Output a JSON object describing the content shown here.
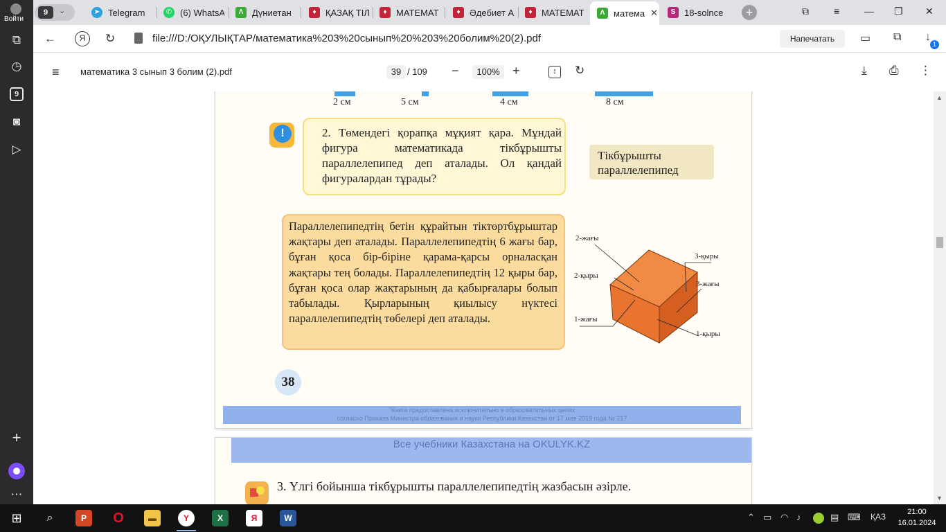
{
  "tab_strip": {
    "profile_label": "Войти",
    "tab_group_count": "9",
    "tabs": [
      {
        "title": "Telegram",
        "fav": "",
        "color": "#2aa3e0"
      },
      {
        "title": "(6) WhatsA",
        "fav": "",
        "color": "#25d366"
      },
      {
        "title": "Дүниетан",
        "fav": "Λ",
        "color": "#3aa935"
      },
      {
        "title": "ҚАЗАҚ ТІЛ",
        "fav": "",
        "color": "#c2253a"
      },
      {
        "title": "МАТЕМАТ",
        "fav": "",
        "color": "#c2253a"
      },
      {
        "title": "Әдебиет А",
        "fav": "",
        "color": "#c2253a"
      },
      {
        "title": "МАТЕМАТ",
        "fav": "",
        "color": "#c2253a"
      },
      {
        "title": "матема",
        "fav": "Λ",
        "color": "#3aa935"
      },
      {
        "title": "18-solnce",
        "fav": "S",
        "color": "#b8287a"
      }
    ]
  },
  "address_bar": {
    "url": "file:///D:/ОҚУЛЫҚТАР/математика%203%20сынып%20%203%20болим%20(2).pdf",
    "print_label": "Напечатать",
    "download_badge": "1"
  },
  "sidebar": {
    "tab_count": "9"
  },
  "pdf_toolbar": {
    "filename": "математика 3 сынып 3 болим (2).pdf",
    "current_page": "39",
    "total_pages": "/ 109",
    "zoom": "100%"
  },
  "page1": {
    "dims": [
      "2 см",
      "5 см",
      "4 см",
      "8 см"
    ],
    "question": "2. Төмендегі қорапқа мұқият қара. Мұндай фигура математикада тікбұрышты параллелепипед деп аталады. Ол қандай фигуралардан тұрады?",
    "term_line1": "Тікбұрышты",
    "term_line2": "параллелепипед",
    "definition": "Параллелепипедтің бетін құрайтын тіктөртбұрыштар жақтары деп аталады. Параллелепипедтің 6 жағы бар, бұған қоса бір-біріне қарама-қарсы орналасқан жақтары тең болады. Параллелепипедтің 12 қыры бар, бұған қоса олар жақтарының да қабырғалары болып табылады. Қырларының қиылысу нүктесі параллелепипедтің төбелері деп аталады.",
    "labels": {
      "face2": "2-жағы",
      "edge2": "2-қыры",
      "face1": "1-жағы",
      "edge3": "3-қыры",
      "face3": "3-жағы",
      "edge1": "1-қыры"
    },
    "page_number": "38",
    "footer_line1": "\"Книга предоставлена исключительно в образовательных целях",
    "footer_line2": "согласно Приказа Министра образования и науки Республики Казахстан от 17 мая 2019 года № 217"
  },
  "page2": {
    "banner": "Все учебники Казахстана на OKULYK.KZ",
    "task3": "3. Үлгі бойынша тікбұрышты параллелепипедтің жазбасын әзірле."
  },
  "taskbar": {
    "language": "ҚАЗ",
    "time": "21:00",
    "date": "16.01.2024"
  },
  "colors": {
    "brick": "#e8742f",
    "brick_top": "#f08a45",
    "brick_side": "#d55f20",
    "blue_block": "#43a0e4"
  }
}
